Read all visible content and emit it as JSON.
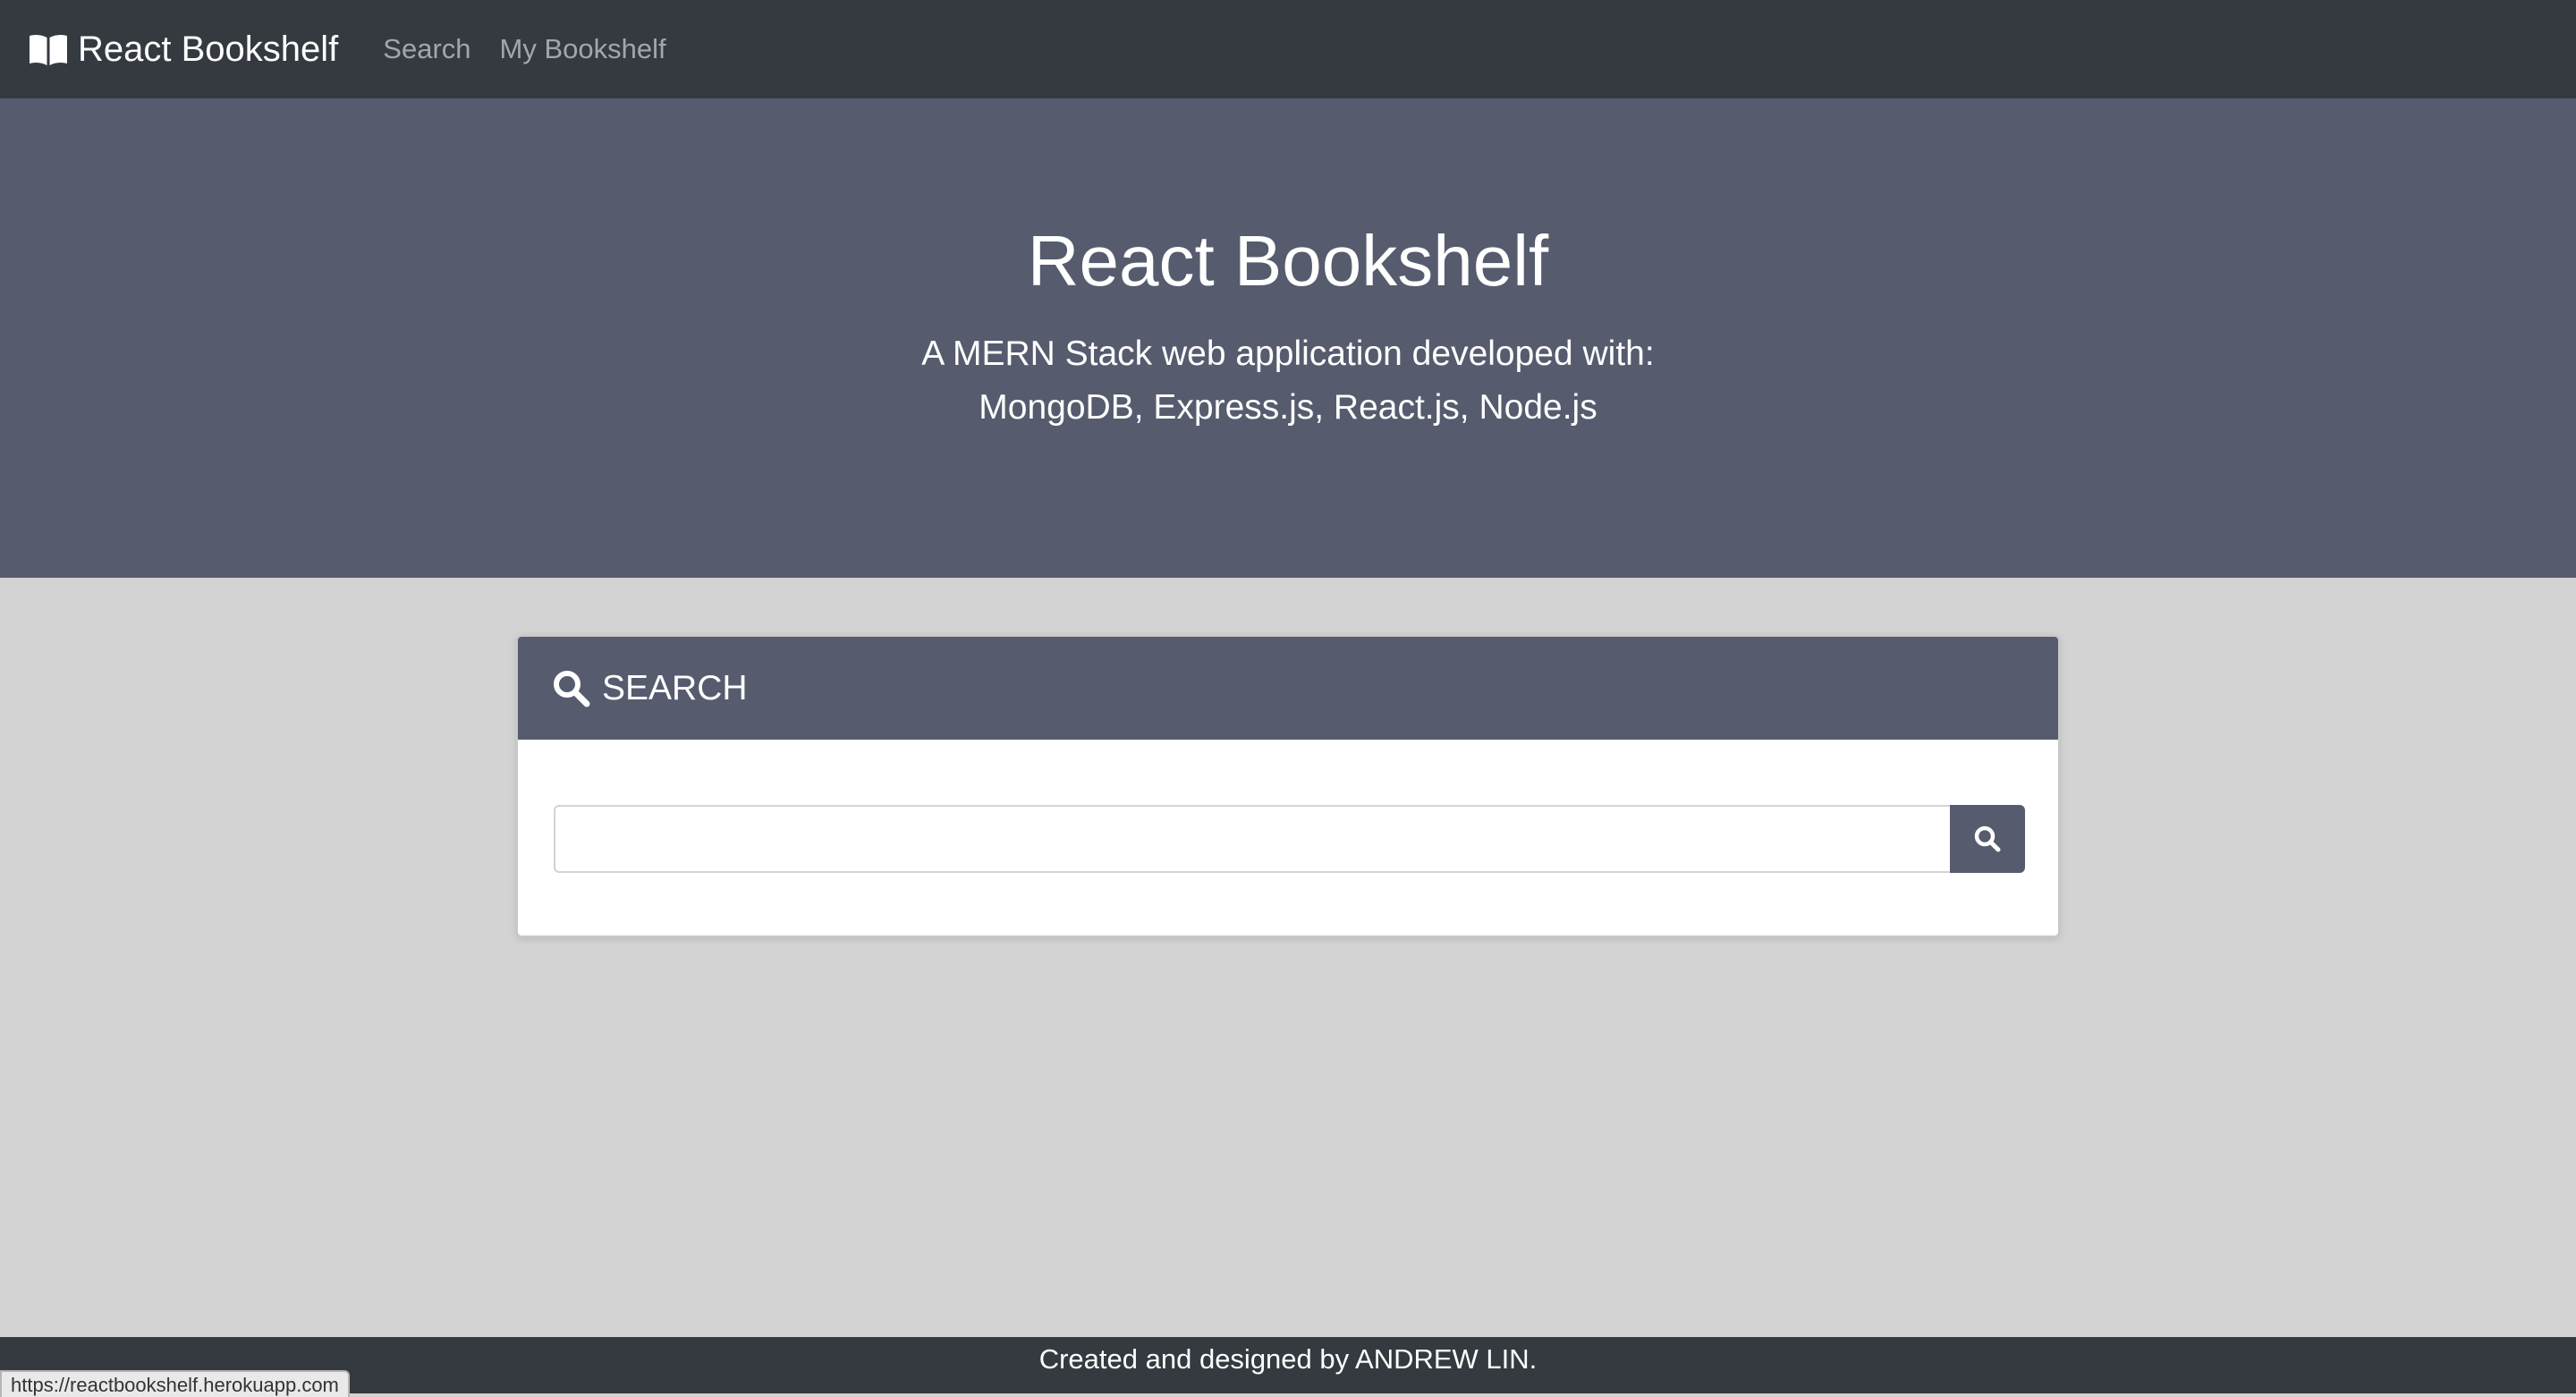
{
  "navbar": {
    "brand": "React Bookshelf",
    "brand_icon": "book-open-icon",
    "links": [
      "Search",
      "My Bookshelf"
    ]
  },
  "jumbotron": {
    "title": "React Bookshelf",
    "subtitle_line1": "A MERN Stack web application developed with:",
    "subtitle_line2": "MongoDB, Express.js, React.js, Node.js"
  },
  "search_card": {
    "header_icon": "search-icon",
    "header_label": "SEARCH",
    "input_value": "",
    "button_icon": "search-icon"
  },
  "footer": {
    "text": "Created and designed by ANDREW LIN."
  },
  "status_bar": {
    "url": "https://reactbookshelf.herokuapp.com"
  },
  "colors": {
    "navbar_bg": "#343a40",
    "jumbotron_bg": "#565b6e",
    "page_bg": "#d3d3d3",
    "accent": "#565b6e"
  }
}
